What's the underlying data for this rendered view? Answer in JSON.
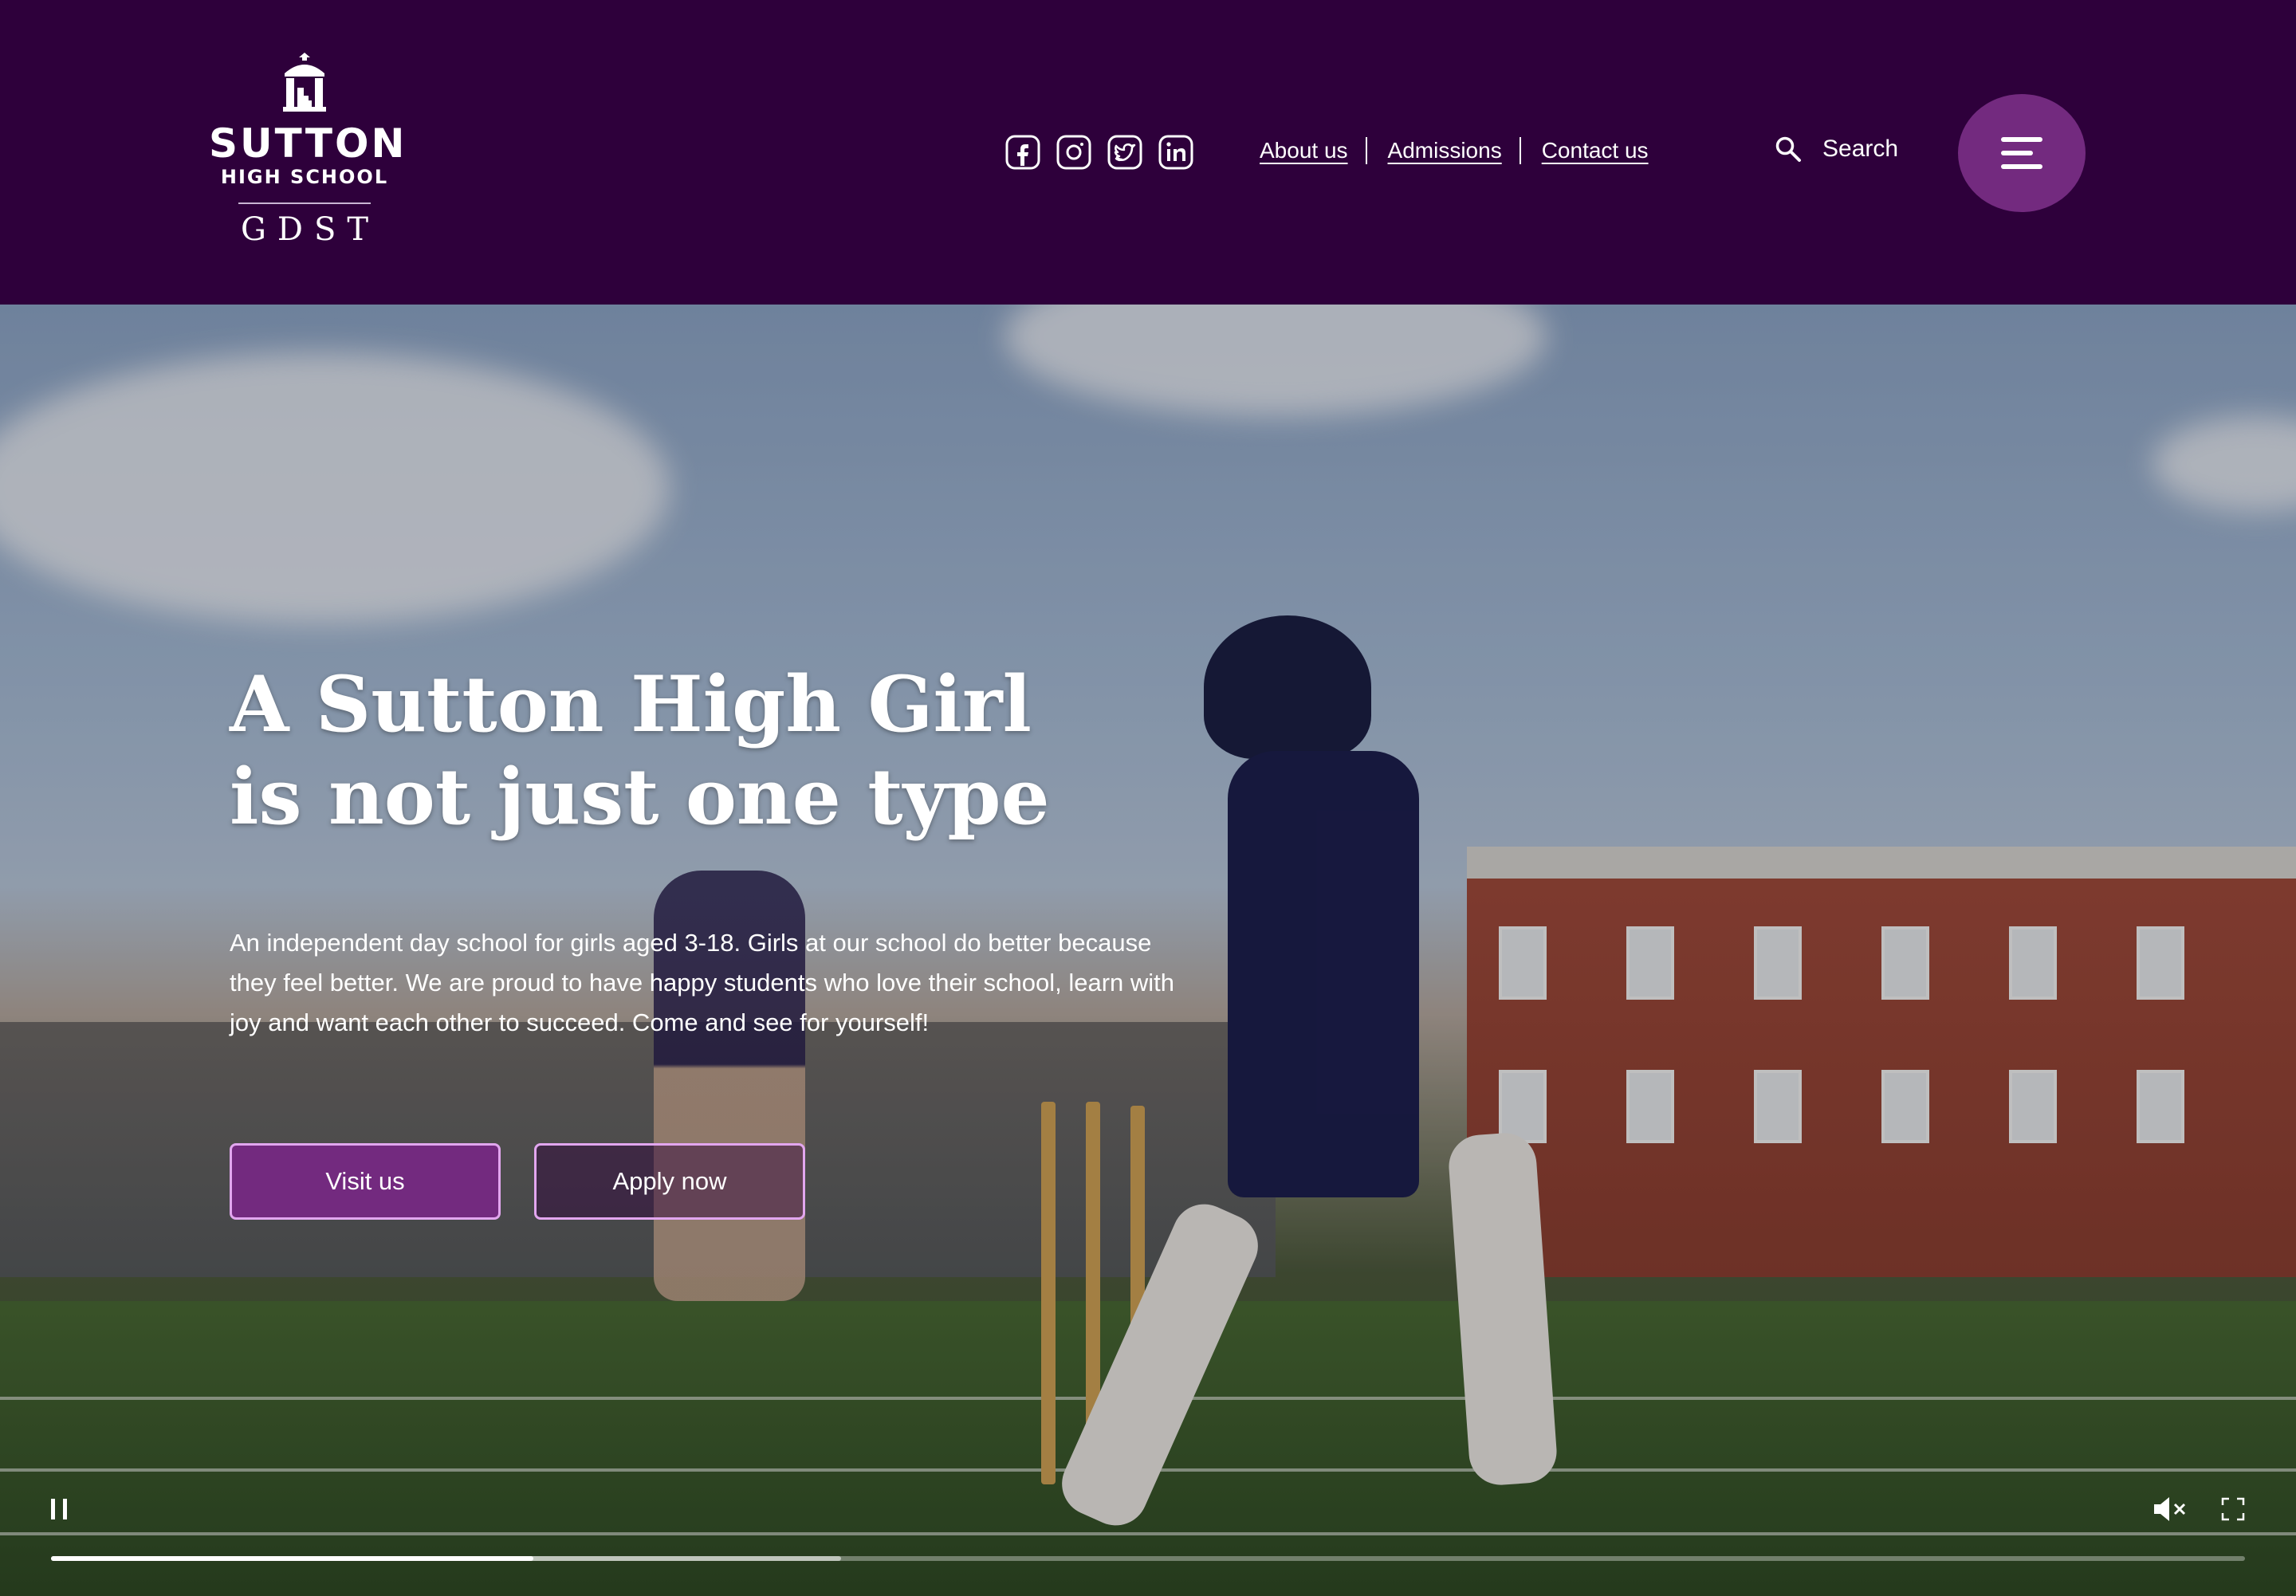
{
  "header": {
    "logo": {
      "name": "SUTTON",
      "sub": "HIGH SCHOOL",
      "org": "GDST"
    },
    "social": [
      {
        "icon": "facebook-icon"
      },
      {
        "icon": "instagram-icon"
      },
      {
        "icon": "twitter-icon"
      },
      {
        "icon": "linkedin-icon"
      }
    ],
    "links": [
      "About us",
      "Admissions",
      "Contact us"
    ],
    "search_label": "Search",
    "menu_icon": "hamburger-menu-icon"
  },
  "hero": {
    "title": "A Sutton High Girl is not just one type",
    "text": "An independent day school for girls aged 3-18. Girls at our school do better because they feel better. We are proud to have happy students who love their school, learn with joy and want each other to succeed. Come and see for yourself!",
    "buttons": {
      "primary": "Visit us",
      "secondary": "Apply now"
    }
  },
  "video": {
    "progress": 0.22,
    "buffered": 0.36,
    "controls": [
      "pause-icon",
      "mute-icon",
      "fullscreen-icon"
    ]
  },
  "colors": {
    "header_bg": "#2e003b",
    "accent": "#732a7f",
    "button_border": "#e2a6ef"
  }
}
